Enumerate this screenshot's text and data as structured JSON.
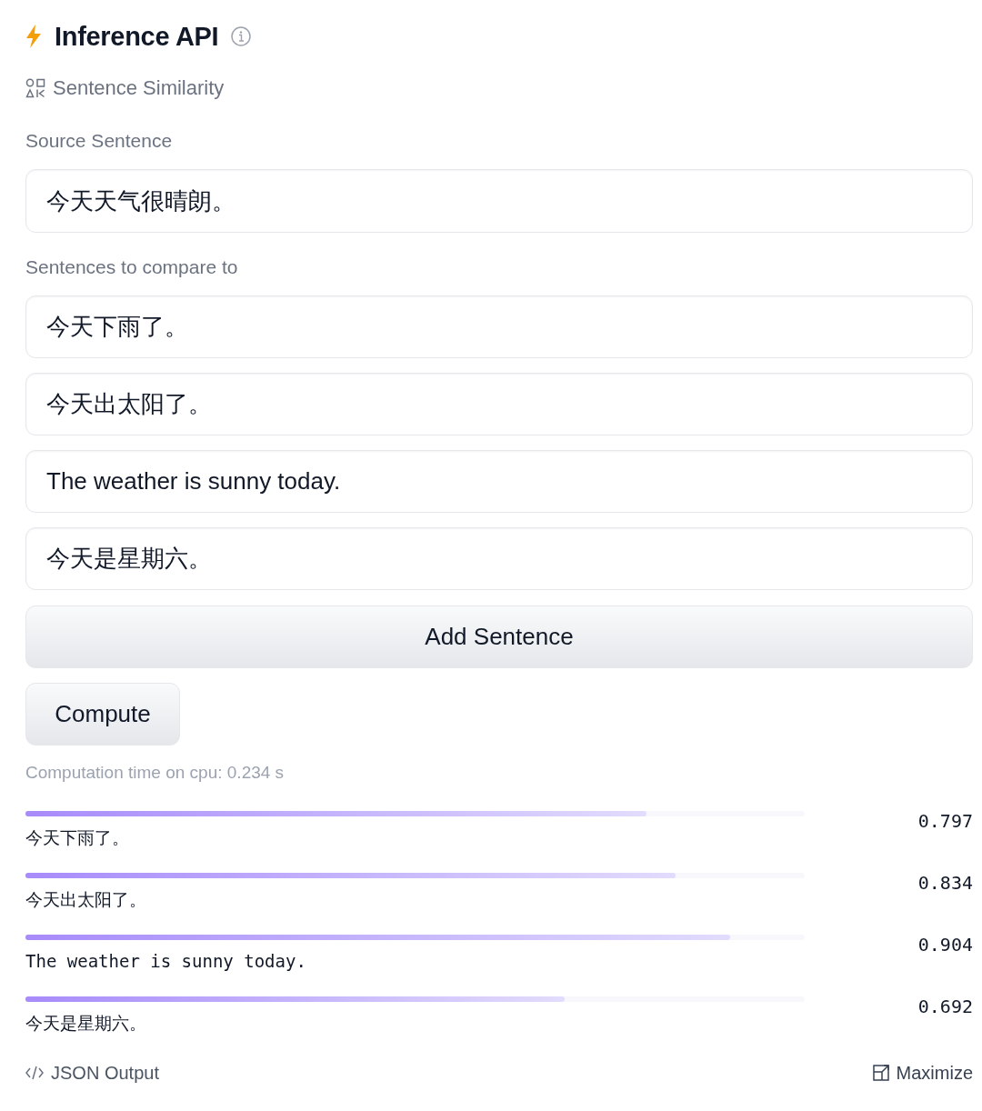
{
  "header": {
    "title": "Inference API"
  },
  "task": {
    "label": "Sentence Similarity"
  },
  "source": {
    "label": "Source Sentence",
    "value": "今天天气很晴朗。"
  },
  "compare": {
    "label": "Sentences to compare to",
    "sentences": [
      "今天下雨了。",
      "今天出太阳了。",
      "The weather is sunny today.",
      "今天是星期六。"
    ]
  },
  "add_button": "Add Sentence",
  "compute_button": "Compute",
  "computation_time": "Computation time on cpu: 0.234 s",
  "results": [
    {
      "label": "今天下雨了。",
      "score": "0.797",
      "level": 0.797
    },
    {
      "label": "今天出太阳了。",
      "score": "0.834",
      "level": 0.834
    },
    {
      "label": "The weather is sunny today.",
      "score": "0.904",
      "level": 0.904
    },
    {
      "label": "今天是星期六。",
      "score": "0.692",
      "level": 0.692
    }
  ],
  "footer": {
    "json_output": "JSON Output",
    "maximize": "Maximize"
  }
}
